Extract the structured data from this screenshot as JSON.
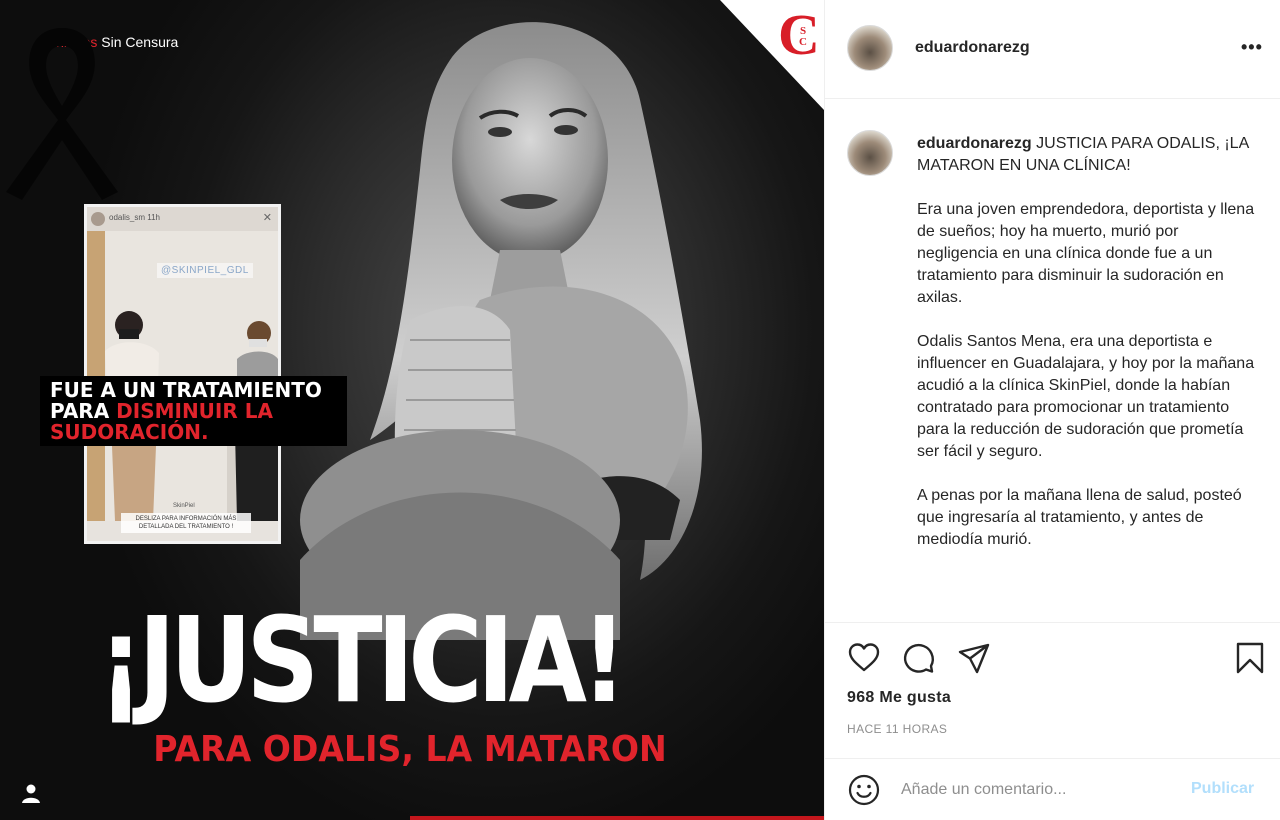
{
  "post_image": {
    "brand_red": "Chiapas",
    "brand_rest": " Sin Censura",
    "publisher_logo_initial": "C",
    "publisher_logo_s": "S",
    "publisher_logo_c": "C",
    "story": {
      "user": "odalis_sm  11h",
      "handle": "@SKINPIEL_GDL",
      "tag": "SkinPiel",
      "footer_note": "DESLIZA PARA INFORMACIÓN MÁS DETALLADA DEL TRATAMIENTO !"
    },
    "caption_line1": "FUE A UN TRATAMIENTO",
    "caption_line2_white": "PARA ",
    "caption_line2_red": "DISMINUIR LA",
    "caption_line3_red": "SUDORACIÓN.",
    "headline": "¡JUSTICIA!",
    "subheadline": "PARA ODALIS, LA MATARON",
    "accent_red": "#e1242c"
  },
  "header": {
    "username": "eduardonarezg",
    "more_icon": "ellipsis-icon"
  },
  "caption": {
    "username": "eduardonarezg",
    "paragraphs": [
      "JUSTICIA PARA ODALIS, ¡LA MATARON EN UNA CLÍNICA!",
      "Era una joven emprendedora, deportista y llena de sueños; hoy ha muerto, murió por negligencia en una clínica donde fue a un tratamiento para disminuir la sudoración en axilas.",
      "Odalis Santos Mena, era una deportista e influencer en Guadalajara, y hoy por la mañana acudió a la clínica SkinPiel, donde la habían contratado para promocionar un tratamiento para la reducción de sudoración que prometía ser fácil y seguro.",
      "A penas por la mañana llena de salud, posteó que ingresaría al tratamiento, y antes de mediodía murió."
    ]
  },
  "actions": {
    "icons": [
      "heart-icon",
      "comment-icon",
      "share-icon",
      "bookmark-icon"
    ],
    "likes": "968 Me gusta",
    "timestamp": "HACE 11 HORAS"
  },
  "comment_box": {
    "placeholder": "Añade un comentario...",
    "publish_label": "Publicar",
    "publish_color": "#b2dffc"
  }
}
